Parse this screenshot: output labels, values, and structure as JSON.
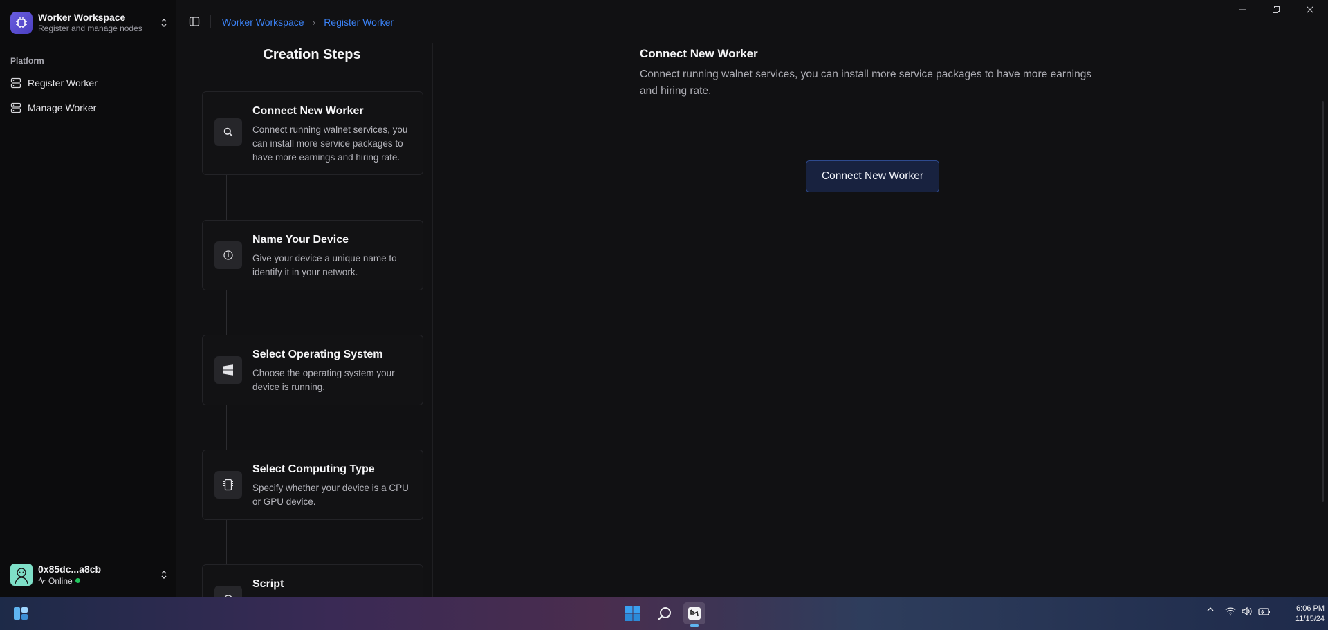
{
  "workspace": {
    "title": "Worker Workspace",
    "subtitle": "Register and manage nodes"
  },
  "sidebar": {
    "section": "Platform",
    "items": [
      {
        "label": "Register Worker",
        "icon": "server-icon"
      },
      {
        "label": "Manage Worker",
        "icon": "server-icon"
      }
    ]
  },
  "user": {
    "address": "0x85dc...a8cb",
    "status": "Online"
  },
  "breadcrumb": {
    "root": "Worker Workspace",
    "current": "Register Worker"
  },
  "steps": {
    "title": "Creation Steps",
    "items": [
      {
        "title": "Connect New Worker",
        "description": "Connect running walnet services, you can install more service packages to have more earnings and hiring rate.",
        "icon": "search-icon"
      },
      {
        "title": "Name Your Device",
        "description": "Give your device a unique name to identify it in your network.",
        "icon": "info-icon"
      },
      {
        "title": "Select Operating System",
        "description": "Choose the operating system your device is running.",
        "icon": "windows-icon"
      },
      {
        "title": "Select Computing Type",
        "description": "Specify whether your device is a CPU or GPU device.",
        "icon": "cpu-icon"
      },
      {
        "title": "Script",
        "description": "",
        "icon": "terminal-icon"
      }
    ]
  },
  "main": {
    "title": "Connect New Worker",
    "description": "Connect running walnet services, you can install more service packages to have more earnings and hiring rate.",
    "button": "Connect New Worker"
  },
  "taskbar": {
    "time": "6:06 PM",
    "date": "11/15/24"
  },
  "colors": {
    "accent": "#3b82f6",
    "online": "#22c55e",
    "button_bg": "#18223f",
    "button_border": "#2e4a8e"
  }
}
